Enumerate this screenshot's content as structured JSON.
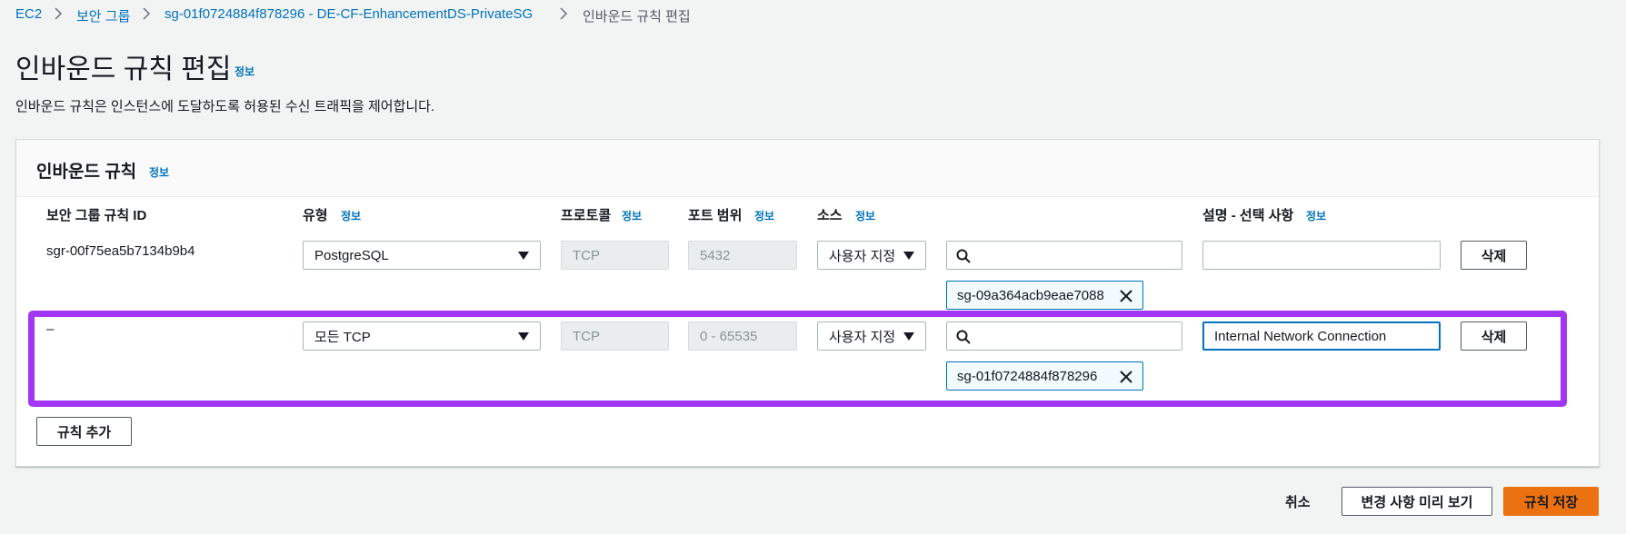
{
  "breadcrumb": {
    "items": [
      "EC2",
      "보안 그룹",
      "sg-01f0724884f878296 - DE-CF-EnhancementDS-PrivateSG",
      "인바운드 규칙 편집"
    ]
  },
  "page": {
    "title": "인바운드 규칙 편집",
    "info": "정보",
    "description": "인바운드 규칙은 인스턴스에 도달하도록 허용된 수신 트래픽을 제어합니다."
  },
  "panel": {
    "title": "인바운드 규칙",
    "info": "정보",
    "columns": {
      "rule_id": "보안 그룹 규칙 ID",
      "type": "유형",
      "protocol": "프로토콜",
      "port_range": "포트 범위",
      "source": "소스",
      "description": "설명 - 선택 사항",
      "info": "정보"
    },
    "rules": [
      {
        "rule_id": "sgr-00f75ea5b7134b9b4",
        "type": "PostgreSQL",
        "protocol": "TCP",
        "port_range": "5432",
        "source_type": "사용자 지정",
        "source_search_value": "",
        "source_token": "sg-09a364acb9eae7088",
        "description": "",
        "delete_label": "삭제"
      },
      {
        "rule_id": "–",
        "type": "모든 TCP",
        "protocol": "TCP",
        "port_range": "0 - 65535",
        "source_type": "사용자 지정",
        "source_search_value": "",
        "source_token": "sg-01f0724884f878296",
        "description": "Internal Network Connection",
        "delete_label": "삭제"
      }
    ],
    "add_rule_label": "규칙 추가"
  },
  "footer": {
    "cancel_label": "취소",
    "preview_label": "변경 사항 미리 보기",
    "save_label": "규칙 저장"
  },
  "colors": {
    "link": "#0073bb",
    "primary_button": "#ec7211",
    "highlight": "#a136f4"
  }
}
